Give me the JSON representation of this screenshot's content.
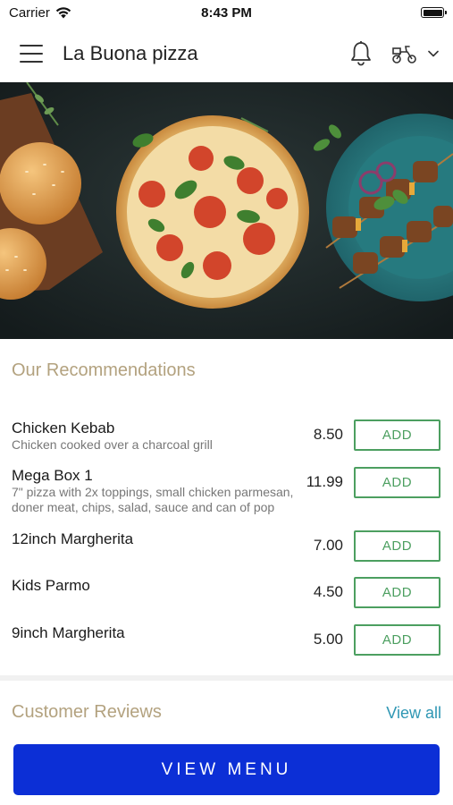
{
  "status_bar": {
    "carrier": "Carrier",
    "time": "8:43 PM"
  },
  "header": {
    "title": "La Buona pizza"
  },
  "sections": {
    "recommendations_title": "Our Recommendations",
    "reviews_title": "Customer Reviews",
    "view_all_label": "View all"
  },
  "menu_items": [
    {
      "name": "Chicken Kebab",
      "description": "Chicken cooked over a charcoal grill",
      "price": "8.50",
      "add_label": "ADD"
    },
    {
      "name": "Mega Box 1",
      "description": "7\" pizza with 2x toppings, small chicken parmesan, doner meat, chips, salad, sauce and can of pop",
      "price": "11.99",
      "add_label": "ADD"
    },
    {
      "name": "12inch Margherita",
      "description": "",
      "price": "7.00",
      "add_label": "ADD"
    },
    {
      "name": "Kids Parmo",
      "description": "",
      "price": "4.50",
      "add_label": "ADD"
    },
    {
      "name": "9inch Margherita",
      "description": "",
      "price": "5.00",
      "add_label": "ADD"
    }
  ],
  "cta": {
    "label": "VIEW MENU"
  },
  "icons": {
    "menu": "hamburger-menu-icon",
    "notifications": "bell-icon",
    "delivery": "scooter-icon",
    "dropdown": "chevron-down-icon"
  },
  "colors": {
    "section_title": "#b3a27f",
    "add_button": "#4c9f60",
    "view_all": "#2f97b4",
    "cta_background": "#0c2fd6"
  }
}
